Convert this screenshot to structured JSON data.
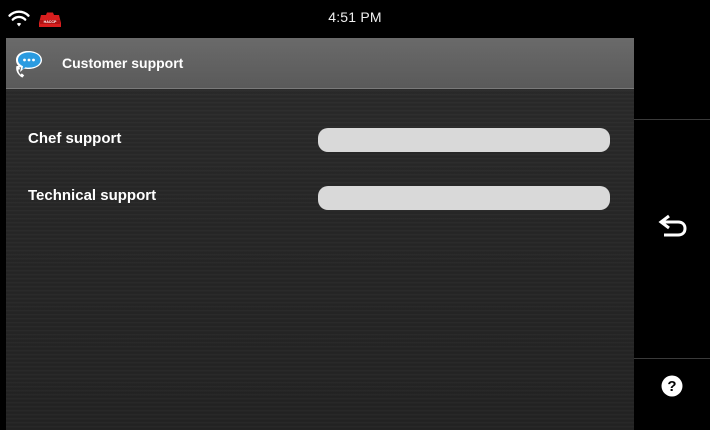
{
  "status_bar": {
    "time": "4:51 PM",
    "wifi_icon": "wifi-icon",
    "badge": {
      "icon": "haccp-badge-icon",
      "label": "HACCP",
      "color": "#d81e1e"
    }
  },
  "header": {
    "title": "Customer support",
    "icon": "customer-support-icon"
  },
  "rows": [
    {
      "label": "Chef support",
      "value": ""
    },
    {
      "label": "Technical support",
      "value": ""
    }
  ],
  "sidebar": {
    "back_icon": "back-arrow-icon",
    "help_icon": "help-icon",
    "help_symbol": "?"
  },
  "colors": {
    "panel_background": "#262626",
    "header_background": "#5f5f5f",
    "field_background": "#d9d9d9",
    "icon_white": "#ffffff",
    "support_icon_blue": "#2b9be0"
  }
}
